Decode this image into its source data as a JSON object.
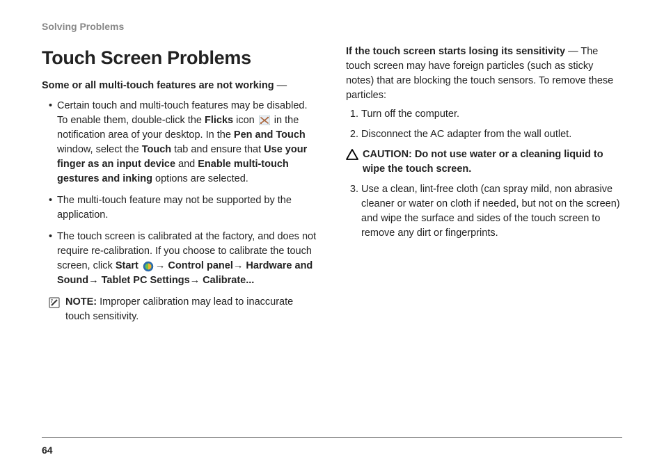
{
  "chapter": "Solving Problems",
  "title": "Touch Screen Problems",
  "section1_lead_bold": "Some or all multi-touch features are not working",
  "section1_lead_tail": " —",
  "bullets": {
    "b1": {
      "t1": "Certain touch and multi-touch features may be disabled. To enable them, double-click the ",
      "flicks": "Flicks",
      "t2": " icon ",
      "t3": " in the notification area of your desktop. In the ",
      "pen": "Pen and Touch",
      "t4": " window, select the ",
      "touch": "Touch",
      "t5": " tab and ensure that ",
      "usefinger": "Use your finger as an input device",
      "t6": " and ",
      "enablemt": "Enable multi-touch gestures and inking",
      "t7": " options are selected."
    },
    "b2": "The multi-touch feature may not be supported by the application.",
    "b3": {
      "t1": "The touch screen is calibrated at the factory, and does not require re-calibration. If you choose to calibrate the touch screen, click ",
      "start": "Start",
      "path": "→ Control panel→ Hardware and Sound→ Tablet PC Settings→ Calibrate..."
    }
  },
  "note": {
    "label": "NOTE:",
    "text": " Improper calibration may lead to inaccurate touch sensitivity."
  },
  "section2_lead_bold": "If the touch screen starts losing its sensitivity",
  "section2_lead_tail": " — The touch screen may have foreign particles (such as sticky notes) that are blocking the touch sensors. To remove these particles:",
  "steps": {
    "s1": "Turn off the computer.",
    "s2": "Disconnect the AC adapter from the wall outlet.",
    "s3": "Use a clean, lint-free cloth (can spray mild, non abrasive cleaner or water on cloth if needed, but not on the screen) and wipe the surface and sides of the touch screen to remove any dirt or fingerprints."
  },
  "caution": {
    "text": "CAUTION: Do not use water or a cleaning liquid to wipe the touch screen."
  },
  "page_number": "64"
}
